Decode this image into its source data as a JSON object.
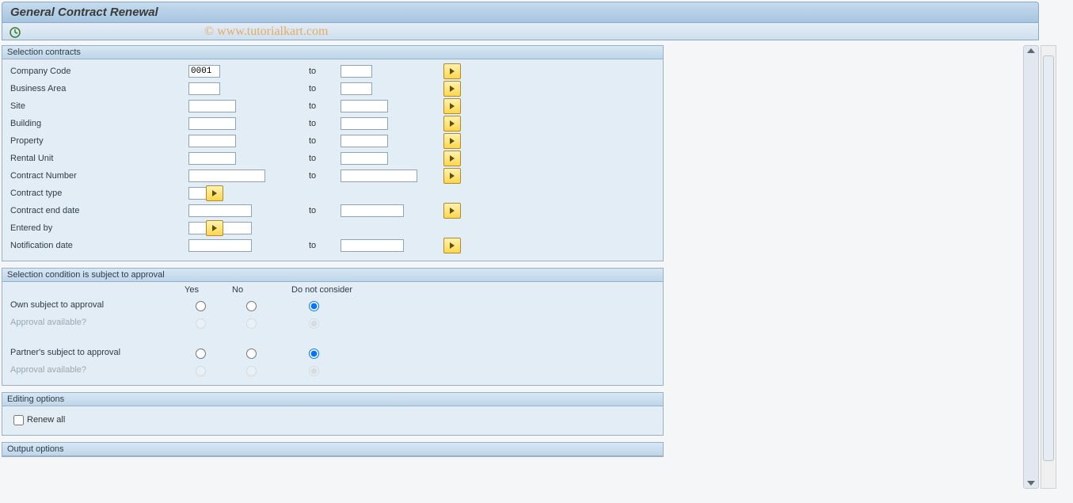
{
  "title": "General Contract Renewal",
  "watermark": "© www.tutorialkart.com",
  "groups": {
    "selection_contracts": {
      "header": "Selection contracts",
      "rows": {
        "company_code": {
          "label": "Company Code",
          "from": "0001",
          "to_label": "to",
          "to": ""
        },
        "business_area": {
          "label": "Business Area",
          "from": "",
          "to_label": "to",
          "to": ""
        },
        "site": {
          "label": "Site",
          "from": "",
          "to_label": "to",
          "to": ""
        },
        "building": {
          "label": "Building",
          "from": "",
          "to_label": "to",
          "to": ""
        },
        "property": {
          "label": "Property",
          "from": "",
          "to_label": "to",
          "to": ""
        },
        "rental_unit": {
          "label": "Rental Unit",
          "from": "",
          "to_label": "to",
          "to": ""
        },
        "contract_number": {
          "label": "Contract Number",
          "from": "",
          "to_label": "to",
          "to": ""
        },
        "contract_type": {
          "label": "Contract type",
          "from": ""
        },
        "contract_end_date": {
          "label": "Contract end date",
          "from": "",
          "to_label": "to",
          "to": ""
        },
        "entered_by": {
          "label": "Entered by",
          "from": ""
        },
        "notification_date": {
          "label": "Notification date",
          "from": "",
          "to_label": "to",
          "to": ""
        }
      }
    },
    "approval": {
      "header": "Selection condition is subject to approval",
      "columns": {
        "yes": "Yes",
        "no": "No",
        "dnc": "Do not consider"
      },
      "rows": {
        "own_subject": {
          "label": "Own subject to approval"
        },
        "own_approval_avail": {
          "label": "Approval available?"
        },
        "partner_subject": {
          "label": "Partner's subject to approval"
        },
        "partner_approval_avail": {
          "label": "Approval available?"
        }
      }
    },
    "editing": {
      "header": "Editing options",
      "renew_all_label": "Renew all"
    },
    "output": {
      "header": "Output options"
    }
  }
}
